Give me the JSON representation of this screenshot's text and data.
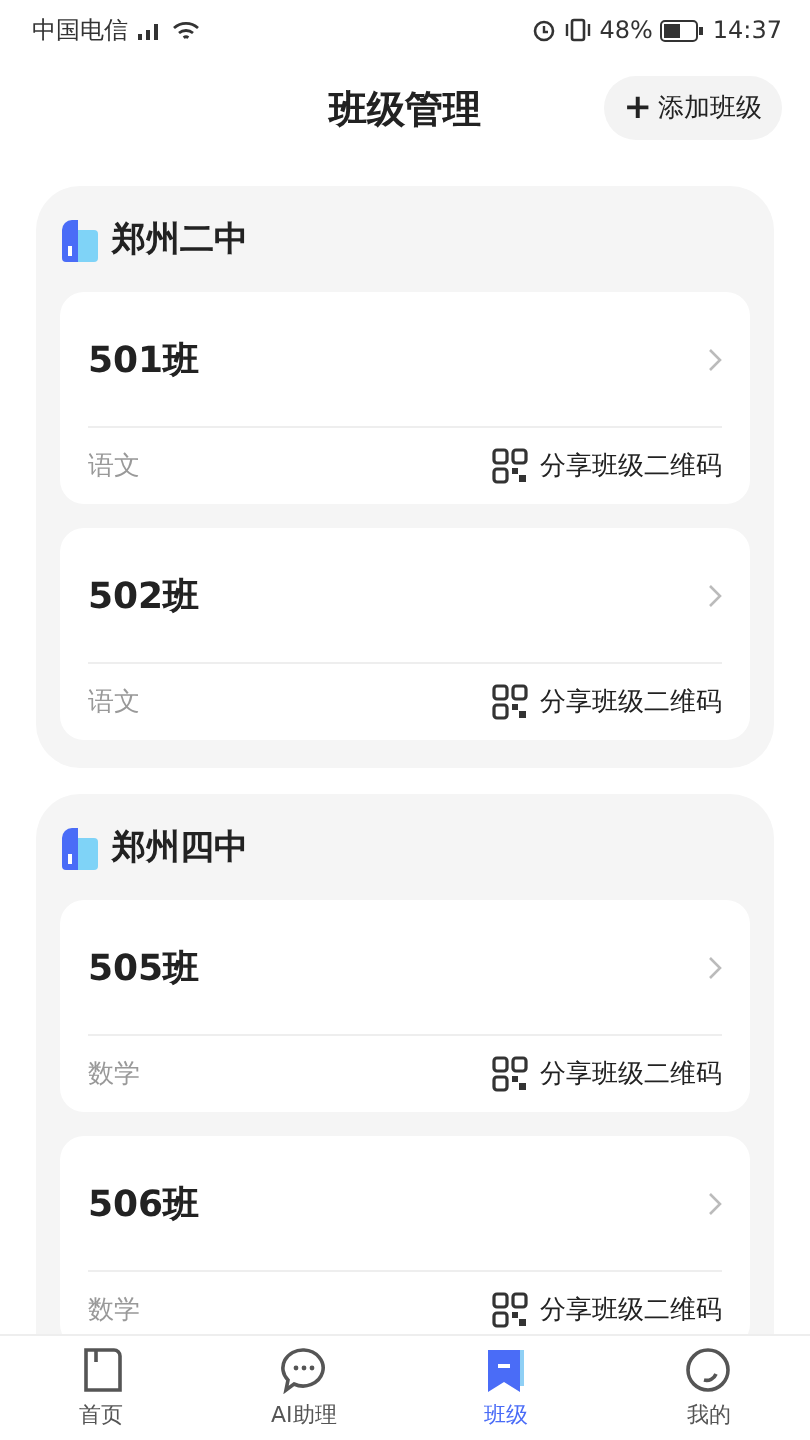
{
  "status_bar": {
    "carrier": "中国电信",
    "battery": "48%",
    "time": "14:37"
  },
  "header": {
    "title": "班级管理",
    "add_button": "添加班级",
    "add_icon": "+"
  },
  "schools": [
    {
      "name": "郑州二中",
      "classes": [
        {
          "name": "501班",
          "subject": "语文",
          "share": "分享班级二维码"
        },
        {
          "name": "502班",
          "subject": "语文",
          "share": "分享班级二维码"
        }
      ]
    },
    {
      "name": "郑州四中",
      "classes": [
        {
          "name": "505班",
          "subject": "数学",
          "share": "分享班级二维码"
        },
        {
          "name": "506班",
          "subject": "数学",
          "share": "分享班级二维码"
        }
      ]
    }
  ],
  "tabs": [
    {
      "label": "首页",
      "kind": "home",
      "selected": false
    },
    {
      "label": "AI助理",
      "kind": "chat",
      "selected": false
    },
    {
      "label": "班级",
      "kind": "class",
      "selected": true
    },
    {
      "label": "我的",
      "kind": "me",
      "selected": false
    }
  ]
}
